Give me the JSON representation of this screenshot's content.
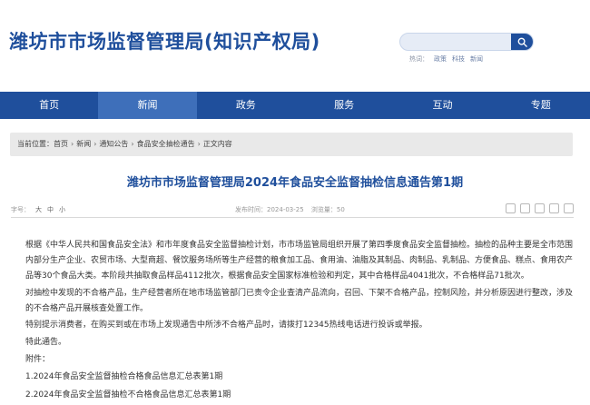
{
  "header": {
    "title": "潍坊市市场监督管理局(知识产权局)",
    "search_placeholder": "",
    "hot_label": "热词：",
    "hot_words": [
      "政策",
      "科技",
      "新闻"
    ]
  },
  "nav": {
    "items": [
      {
        "label": "首页"
      },
      {
        "label": "新闻"
      },
      {
        "label": "政务"
      },
      {
        "label": "服务"
      },
      {
        "label": "互动"
      },
      {
        "label": "专题"
      }
    ],
    "active_index": 1
  },
  "breadcrumb": {
    "prefix": "当前位置：",
    "items": [
      "首页",
      "新闻",
      "通知公告",
      "食品安全抽检通告",
      "正文内容"
    ]
  },
  "article": {
    "title": "潍坊市市场监督管理局2024年食品安全监督抽检信息通告第1期",
    "font_size_label": "字号：",
    "font_sizes": [
      "大",
      "中",
      "小"
    ],
    "publish_time": "发布时间：2024-03-25",
    "views": "浏览量：50",
    "paragraphs": [
      "根据《中华人民共和国食品安全法》和市年度食品安全监督抽检计划，市市场监管局组织开展了第四季度食品安全监督抽检。抽检的品种主要是全市范围内部分生产企业、农贸市场、大型商超、餐饮服务场所等生产经营的粮食加工品、食用油、油脂及其制品、肉制品、乳制品、方便食品、糕点、食用农产品等30个食品大类。本阶段共抽取食品样品4112批次，根据食品安全国家标准检验和判定，其中合格样品4041批次，不合格样品71批次。",
      "对抽检中发现的不合格产品，生产经营者所在地市场监管部门已责令企业查清产品流向，召回、下架不合格产品，控制风险，并分析原因进行整改，涉及的不合格产品开展核查处置工作。",
      "特别提示消费者，在购买到或在市场上发现通告中所涉不合格产品时，请拨打12345热线电话进行投诉或举报。",
      "特此通告。",
      "附件：",
      "1.2024年食品安全监督抽检合格食品信息汇总表第1期",
      "2.2024年食品安全监督抽检不合格食品信息汇总表第1期"
    ]
  },
  "colors": {
    "brand": "#1f4f9c",
    "nav_active": "#3e6fba",
    "breadcrumb_bg": "#e9e9e9"
  }
}
